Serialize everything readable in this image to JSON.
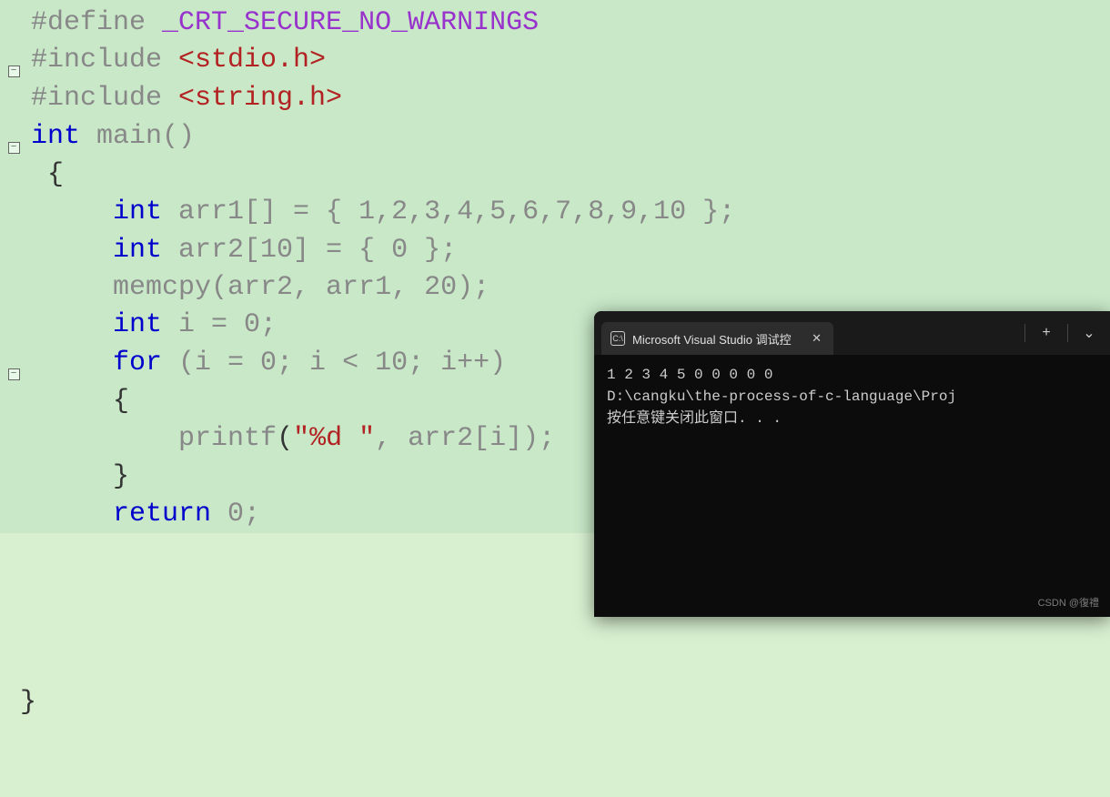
{
  "code": {
    "line1_preproc": "#define ",
    "line1_macro": "_CRT_SECURE_NO_WARNINGS",
    "line2_preproc": "#include ",
    "line2_header": "<stdio.h>",
    "line3_preproc": "#include ",
    "line3_header": "<string.h>",
    "line4_int": "int",
    "line4_main": " main()",
    "line5": "{",
    "line6_int": "int",
    "line6_rest": " arr1[] = { 1,2,3,4,5,6,7,8,9,10 };",
    "line7_int": "int",
    "line7_rest": " arr2[10] = { 0 };",
    "line8": "memcpy(arr2, arr1, 20);",
    "line9_int": "int",
    "line9_rest": " i = 0;",
    "line10_for": "for",
    "line10_rest": " (i = 0; i < 10; i++)",
    "line11": "{",
    "line12_printf": "printf",
    "line12_open": "(",
    "line12_str": "\"%d \"",
    "line12_rest": ", arr2[i]);",
    "line13": "}",
    "line14_return": "return",
    "line14_rest": " 0;",
    "line15": "}"
  },
  "terminal": {
    "tab_title": "Microsoft Visual Studio 调试控",
    "output_line1": "1 2 3 4 5 0 0 0 0 0",
    "output_line2": "D:\\cangku\\the-process-of-c-language\\Proj",
    "output_line3": "按任意键关闭此窗口. . ."
  },
  "fold_minus": "−",
  "tab_icon_text": "C:\\",
  "plus_icon": "+",
  "close_icon": "✕",
  "chevron_icon": "⌄",
  "watermark": "CSDN @復禮"
}
